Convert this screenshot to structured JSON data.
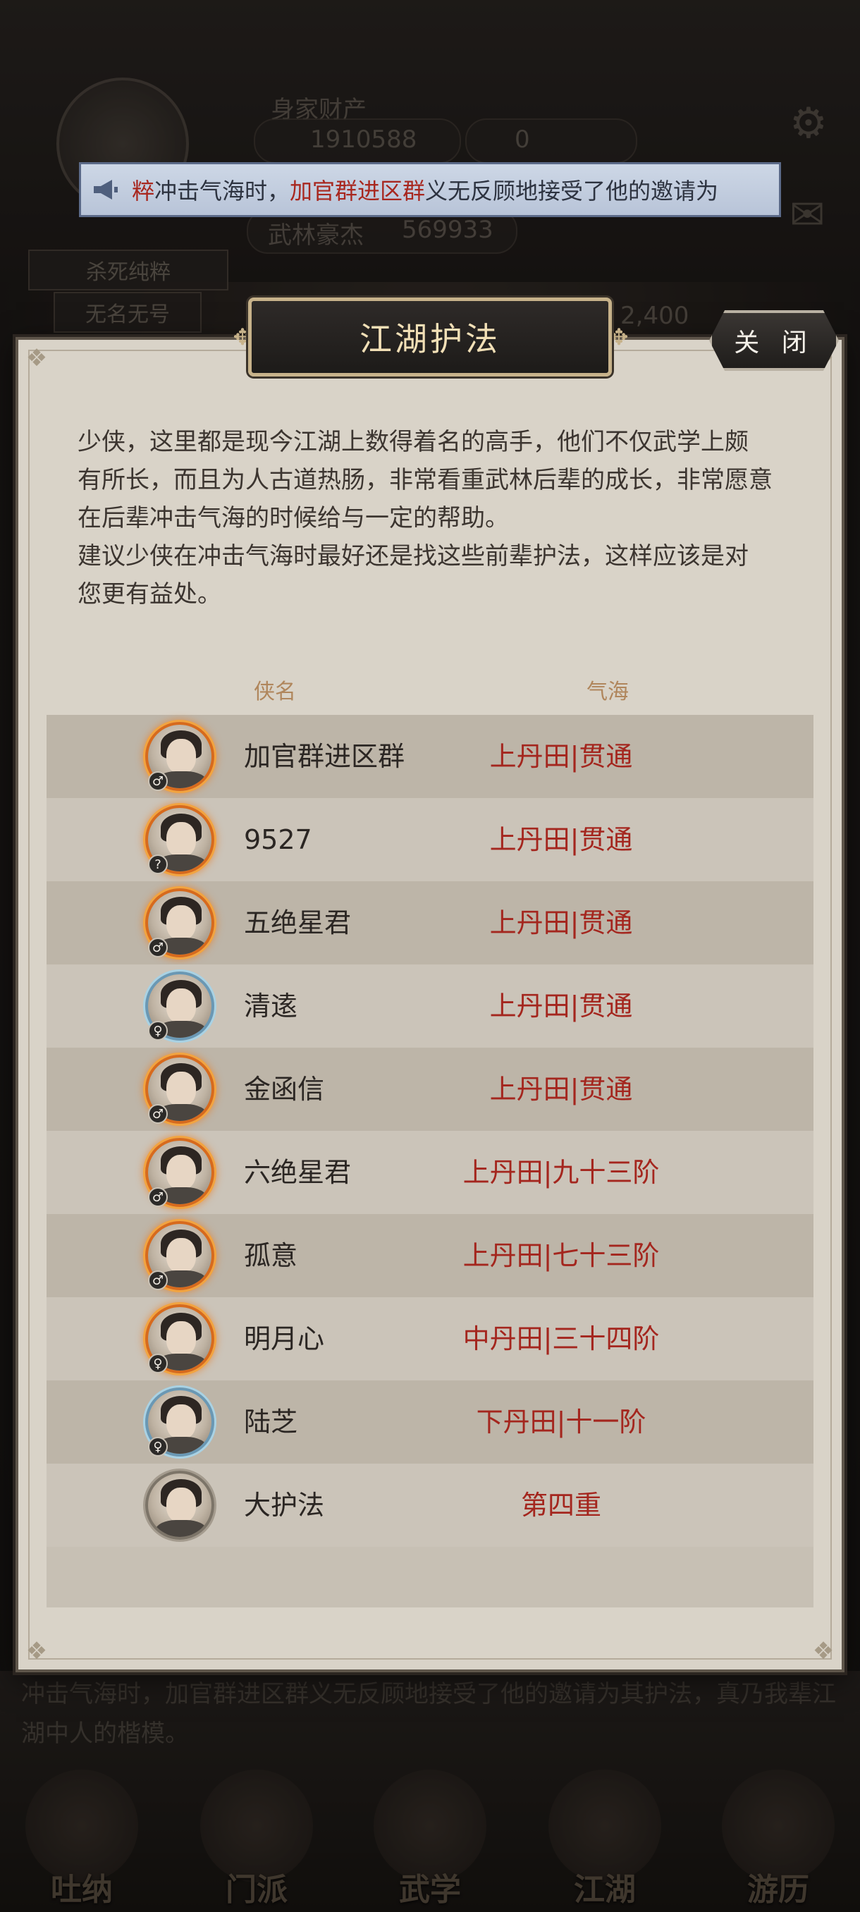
{
  "background": {
    "wealth_label": "身家财产",
    "coins": "1910588",
    "jade": "0",
    "title_label": "武林豪杰",
    "power": "569933",
    "tag_1": "杀死纯粹",
    "tag_2": "无名无号",
    "right_value": "2,400",
    "news_text": "冲击气海时，加官群进区群义无反顾地接受了他的邀请为其护法，真乃我辈江湖中人的楷模。",
    "nav": [
      "吐纳",
      "门派",
      "武学",
      "江湖",
      "游历"
    ]
  },
  "marquee": {
    "prefix": "粹",
    "text_1": "冲击气海时，",
    "highlight": "加官群进区群",
    "text_2": "义无反顾地接受了他的邀请为"
  },
  "dialog": {
    "title": "江湖护法",
    "close_label": "关 闭",
    "description": [
      "少侠，这里都是现今江湖上数得着名的高手，他们不仅武学上颇",
      "有所长，而且为人古道热肠，非常看重武林后辈的成长，非常愿意",
      "在后辈冲击气海的时候给与一定的帮助。",
      "建议少侠在冲击气海时最好还是找这些前辈护法，这样应该是对",
      "您更有益处。"
    ],
    "columns": {
      "name": "侠名",
      "level": "气海"
    },
    "rows": [
      {
        "name": "加官群进区群",
        "level": "上丹田|贯通",
        "gender": "♂",
        "frame": "fire"
      },
      {
        "name": "9527",
        "level": "上丹田|贯通",
        "gender": "?",
        "frame": "fire"
      },
      {
        "name": "五绝星君",
        "level": "上丹田|贯通",
        "gender": "♂",
        "frame": "fire"
      },
      {
        "name": "清逺",
        "level": "上丹田|贯通",
        "gender": "♀",
        "frame": "blue"
      },
      {
        "name": "金函信",
        "level": "上丹田|贯通",
        "gender": "♂",
        "frame": "fire"
      },
      {
        "name": "六绝星君",
        "level": "上丹田|九十三阶",
        "gender": "♂",
        "frame": "fire"
      },
      {
        "name": "孤意",
        "level": "上丹田|七十三阶",
        "gender": "♂",
        "frame": "fire"
      },
      {
        "name": "明月心",
        "level": "中丹田|三十四阶",
        "gender": "♀",
        "frame": "fire"
      },
      {
        "name": "陆芝",
        "level": "下丹田|十一阶",
        "gender": "♀",
        "frame": "blue"
      },
      {
        "name": "大护法",
        "level": "第四重",
        "gender": "",
        "frame": "plain"
      }
    ]
  }
}
